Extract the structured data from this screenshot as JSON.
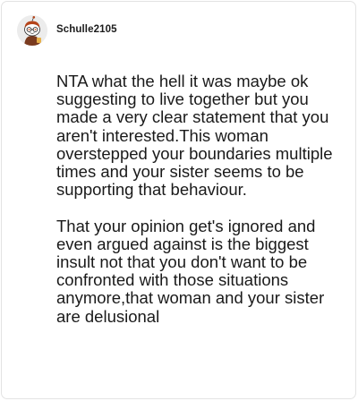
{
  "comment": {
    "username": "Schulle2105",
    "avatar_icon": "snoo-avatar-icon",
    "paragraphs": [
      "NTA what the hell it was maybe ok suggesting to live together but you made a very clear statement that you aren't interested.This woman overstepped your boundaries multiple times and your sister seems to be supporting that behaviour.",
      "That your opinion get's ignored and even argued against is the biggest insult not that you don't want to be confronted with those situations anymore,that woman and your sister are delusional"
    ]
  },
  "colors": {
    "text": "#1a1a1a",
    "border": "#e3e3e3",
    "avatar_bg": "#ececec"
  }
}
